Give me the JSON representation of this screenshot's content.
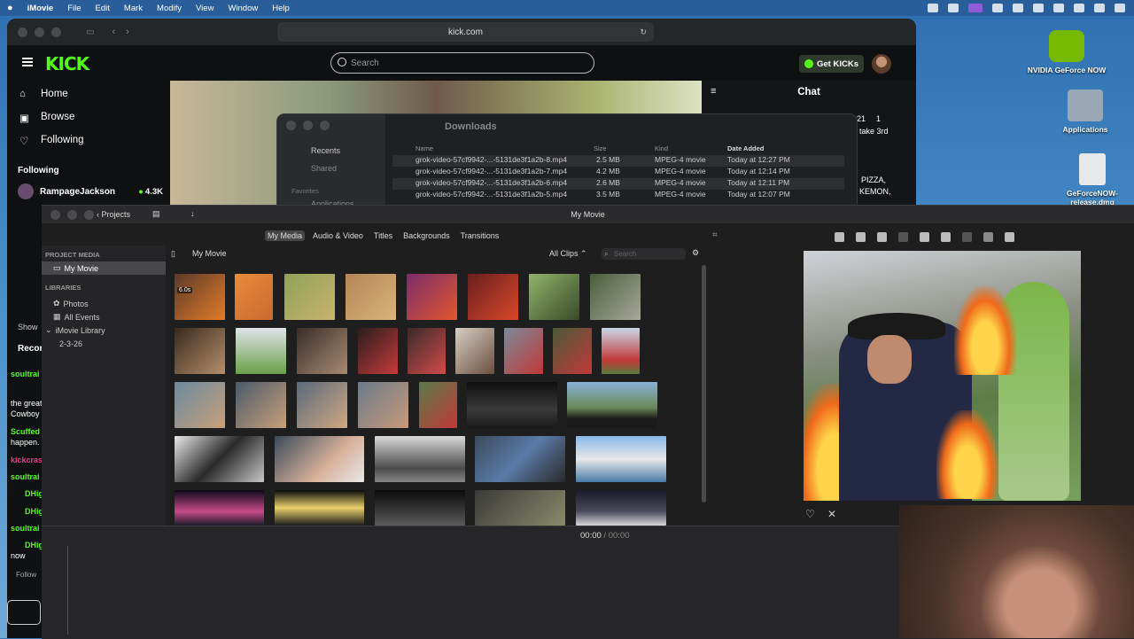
{
  "menubar": {
    "apple": "",
    "app": "iMovie",
    "items": [
      "File",
      "Edit",
      "Mark",
      "Modify",
      "View",
      "Window",
      "Help"
    ]
  },
  "desktop": {
    "icons": [
      {
        "label": "NVIDIA GeForce NOW",
        "color": "#76b900"
      },
      {
        "label": "Applications",
        "color": "#9aa8b6"
      },
      {
        "label": "GeForceNOW-release.dmg",
        "color": "#e6e8ea"
      }
    ]
  },
  "safari": {
    "url": "kick.com"
  },
  "kick": {
    "logo": "KICK",
    "search_placeholder": "Search",
    "get_kicks": "Get KICKs",
    "nav": [
      "Home",
      "Browse",
      "Following"
    ],
    "following_header": "Following",
    "streamers": [
      {
        "name": "RampageJackson",
        "viewers": "4.3K"
      }
    ],
    "show_more": "Show",
    "recommended": "Recor",
    "chat_title": "Chat",
    "chat_snippets": [
      {
        "text": "21",
        "color": "#ffffff"
      },
      {
        "text": "1",
        "color": "#ffffff"
      },
      {
        "text": "take 3rd",
        "color": "#ffffff"
      },
      {
        "text": "PIZZA,",
        "color": "#ffffff"
      },
      {
        "text": "KEMON,",
        "color": "#ffffff"
      }
    ],
    "left_chat": [
      {
        "text": "soultrai",
        "color": "#53fc18"
      },
      {
        "text": "the great",
        "color": "#ffffff"
      },
      {
        "text": "Cowboy",
        "color": "#ffffff"
      },
      {
        "text": "Scuffed",
        "color": "#53fc18"
      },
      {
        "text": "happen.",
        "color": "#ffffff"
      },
      {
        "text": "kickcras",
        "color": "#e0408a"
      },
      {
        "text": "soultrai",
        "color": "#53fc18"
      },
      {
        "text": "DHig",
        "color": "#53fc18"
      },
      {
        "text": "DHig",
        "color": "#53fc18"
      },
      {
        "text": "soultrai",
        "color": "#53fc18"
      },
      {
        "text": "DHig",
        "color": "#53fc18"
      },
      {
        "text": "now",
        "color": "#ffffff"
      },
      {
        "text": "Follow",
        "color": "#aaaaaa"
      }
    ]
  },
  "finder": {
    "title": "Downloads",
    "sidebar": [
      "Recents",
      "Shared",
      "Favorites",
      "Applications"
    ],
    "columns": [
      "Name",
      "Size",
      "Kind",
      "Date Added"
    ],
    "rows": [
      {
        "name": "grok-video-57cf9942-...-5131de3f1a2b-8.mp4",
        "size": "2.5 MB",
        "kind": "MPEG-4 movie",
        "date": "Today at 12:27 PM"
      },
      {
        "name": "grok-video-57cf9942-...-5131de3f1a2b-7.mp4",
        "size": "4.2 MB",
        "kind": "MPEG-4 movie",
        "date": "Today at 12:14 PM"
      },
      {
        "name": "grok-video-57cf9942-...-5131de3f1a2b-6.mp4",
        "size": "2.6 MB",
        "kind": "MPEG-4 movie",
        "date": "Today at 12:11 PM"
      },
      {
        "name": "grok-video-57cf9942-...-5131de3f1a2b-5.mp4",
        "size": "3.5 MB",
        "kind": "MPEG-4 movie",
        "date": "Today at 12:07 PM"
      }
    ]
  },
  "imovie": {
    "title": "My Movie",
    "projects": "Projects",
    "tabs": [
      "My Media",
      "Audio & Video",
      "Titles",
      "Backgrounds",
      "Transitions"
    ],
    "project_media_header": "PROJECT MEDIA",
    "project_item": "My Movie",
    "libraries_header": "LIBRARIES",
    "libraries": [
      "Photos",
      "All Events",
      "iMovie Library",
      "2-3-26"
    ],
    "browser_title": "My Movie",
    "filter": "All Clips",
    "search_placeholder": "Search",
    "clip_duration": "6.0s",
    "timecode_current": "00:00",
    "timecode_sep": "/",
    "timecode_total": "00:00"
  }
}
